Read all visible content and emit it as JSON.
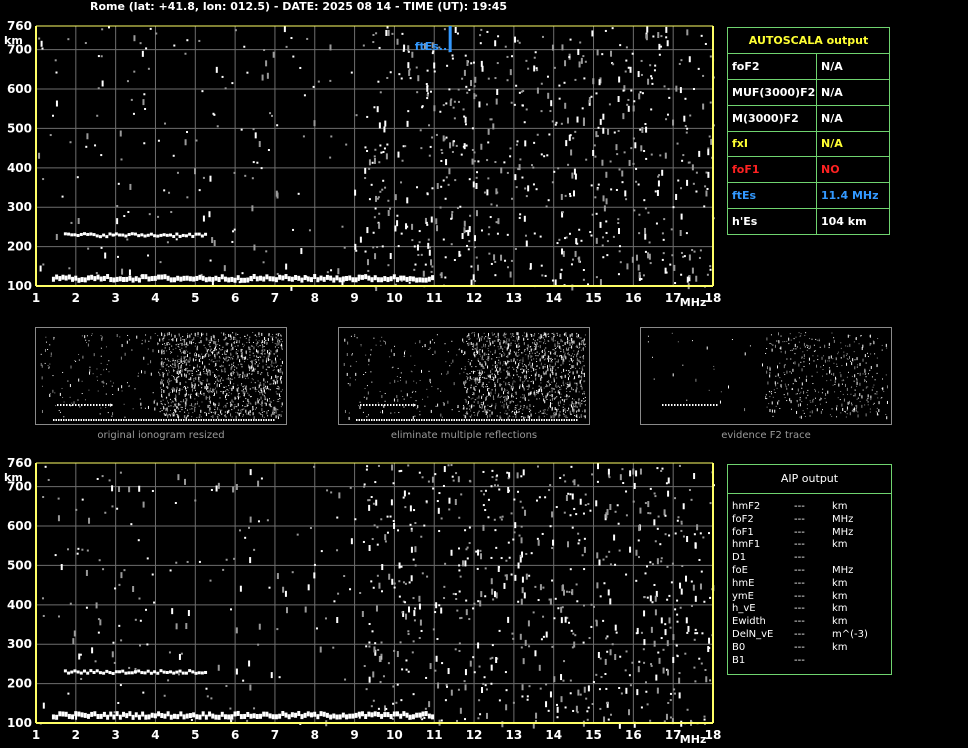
{
  "header": "Rome (lat: +41.8, lon: 012.5) - DATE: 2025 08 14 - TIME (UT): 19:45",
  "autoscala": {
    "title": "AUTOSCALA output",
    "rows": [
      {
        "label": "foF2",
        "value": "N/A",
        "color": "#ffffff"
      },
      {
        "label": "MUF(3000)F2",
        "value": "N/A",
        "color": "#ffffff"
      },
      {
        "label": "M(3000)F2",
        "value": "N/A",
        "color": "#ffffff"
      },
      {
        "label": "fxI",
        "value": "N/A",
        "color": "#ffff33"
      },
      {
        "label": "foF1",
        "value": "NO",
        "color": "#ff2222"
      },
      {
        "label": "ftEs",
        "value": "11.4 MHz",
        "color": "#3399ff"
      },
      {
        "label": "h'Es",
        "value": "104     km",
        "color": "#ffffff"
      }
    ]
  },
  "aip": {
    "title": "AIP output",
    "rows": [
      {
        "name": "hmF2",
        "value": "---",
        "unit": "km"
      },
      {
        "name": "foF2",
        "value": "---",
        "unit": "MHz"
      },
      {
        "name": "foF1",
        "value": "---",
        "unit": "MHz"
      },
      {
        "name": "hmF1",
        "value": "---",
        "unit": "km"
      },
      {
        "name": "D1",
        "value": "---",
        "unit": ""
      },
      {
        "name": "foE",
        "value": "---",
        "unit": "MHz"
      },
      {
        "name": "hmE",
        "value": "---",
        "unit": "km"
      },
      {
        "name": "ymE",
        "value": "---",
        "unit": "km"
      },
      {
        "name": "h_vE",
        "value": "---",
        "unit": "km"
      },
      {
        "name": "Ewidth",
        "value": "---",
        "unit": "km"
      },
      {
        "name": "DelN_vE",
        "value": "---",
        "unit": "m^(-3)"
      },
      {
        "name": "B0",
        "value": "---",
        "unit": "km"
      },
      {
        "name": "B1",
        "value": "---",
        "unit": ""
      }
    ]
  },
  "thumbnails": [
    {
      "caption": "original ionogram resized"
    },
    {
      "caption": "eliminate multiple reflections"
    },
    {
      "caption": "evidence F2 trace"
    }
  ],
  "chart_data": [
    {
      "type": "scatter",
      "name": "ionogram-top",
      "xlabel": "MHz",
      "ylabel": "km",
      "xlim": [
        1,
        18
      ],
      "ylim": [
        100,
        760
      ],
      "xticks": [
        1,
        2,
        3,
        4,
        5,
        6,
        7,
        8,
        9,
        10,
        11,
        12,
        13,
        14,
        15,
        16,
        17,
        18
      ],
      "yticks": [
        100,
        200,
        300,
        400,
        500,
        600,
        700,
        760
      ],
      "grid": true,
      "annotation": {
        "text": "ftEs",
        "x": 11.4,
        "color": "#3399ff"
      },
      "traces": [
        {
          "name": "Es trace",
          "x": [
            1.4,
            11.0
          ],
          "y": 118,
          "color": "#ffffff"
        },
        {
          "name": "Es second-hop trace",
          "x": [
            1.7,
            5.3
          ],
          "y": 228,
          "color": "#ffffff"
        }
      ]
    },
    {
      "type": "scatter",
      "name": "ionogram-bottom",
      "xlabel": "MHz",
      "ylabel": "km",
      "xlim": [
        1,
        18
      ],
      "ylim": [
        100,
        760
      ],
      "xticks": [
        1,
        2,
        3,
        4,
        5,
        6,
        7,
        8,
        9,
        10,
        11,
        12,
        13,
        14,
        15,
        16,
        17,
        18
      ],
      "yticks": [
        100,
        200,
        300,
        400,
        500,
        600,
        700,
        760
      ],
      "grid": true,
      "traces": [
        {
          "name": "Es trace",
          "x": [
            1.4,
            11.0
          ],
          "y": 118,
          "color": "#ffffff"
        },
        {
          "name": "Es second-hop trace",
          "x": [
            1.7,
            5.3
          ],
          "y": 228,
          "color": "#ffffff"
        }
      ]
    }
  ],
  "colors": {
    "axis": "#ffff66",
    "grid": "#6e6e6e",
    "panel_border": "#6fd36f",
    "tick_text": "#ffffff"
  }
}
